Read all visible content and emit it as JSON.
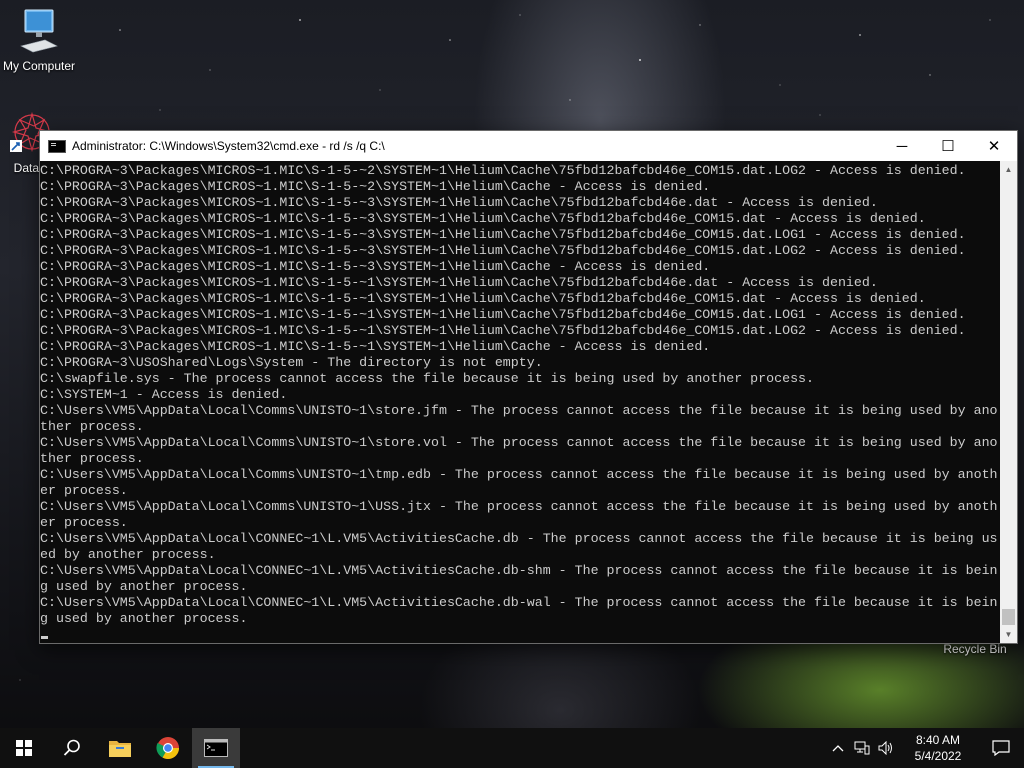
{
  "desktop": {
    "icons": [
      {
        "label": "My Computer"
      },
      {
        "label": "DataW"
      },
      {
        "label": "Recycle Bin"
      }
    ]
  },
  "window": {
    "title": "Administrator: C:\\Windows\\System32\\cmd.exe - rd  /s /q C:\\",
    "controls": {
      "minimize": "─",
      "maximize": "☐",
      "close": "✕"
    }
  },
  "console": {
    "lines": [
      "C:\\PROGRA~3\\Packages\\MICROS~1.MIC\\S-1-5-~2\\SYSTEM~1\\Helium\\Cache\\75fbd12bafcbd46e_COM15.dat.LOG2 - Access is denied.",
      "C:\\PROGRA~3\\Packages\\MICROS~1.MIC\\S-1-5-~2\\SYSTEM~1\\Helium\\Cache - Access is denied.",
      "C:\\PROGRA~3\\Packages\\MICROS~1.MIC\\S-1-5-~3\\SYSTEM~1\\Helium\\Cache\\75fbd12bafcbd46e.dat - Access is denied.",
      "C:\\PROGRA~3\\Packages\\MICROS~1.MIC\\S-1-5-~3\\SYSTEM~1\\Helium\\Cache\\75fbd12bafcbd46e_COM15.dat - Access is denied.",
      "C:\\PROGRA~3\\Packages\\MICROS~1.MIC\\S-1-5-~3\\SYSTEM~1\\Helium\\Cache\\75fbd12bafcbd46e_COM15.dat.LOG1 - Access is denied.",
      "C:\\PROGRA~3\\Packages\\MICROS~1.MIC\\S-1-5-~3\\SYSTEM~1\\Helium\\Cache\\75fbd12bafcbd46e_COM15.dat.LOG2 - Access is denied.",
      "C:\\PROGRA~3\\Packages\\MICROS~1.MIC\\S-1-5-~3\\SYSTEM~1\\Helium\\Cache - Access is denied.",
      "C:\\PROGRA~3\\Packages\\MICROS~1.MIC\\S-1-5-~1\\SYSTEM~1\\Helium\\Cache\\75fbd12bafcbd46e.dat - Access is denied.",
      "C:\\PROGRA~3\\Packages\\MICROS~1.MIC\\S-1-5-~1\\SYSTEM~1\\Helium\\Cache\\75fbd12bafcbd46e_COM15.dat - Access is denied.",
      "C:\\PROGRA~3\\Packages\\MICROS~1.MIC\\S-1-5-~1\\SYSTEM~1\\Helium\\Cache\\75fbd12bafcbd46e_COM15.dat.LOG1 - Access is denied.",
      "C:\\PROGRA~3\\Packages\\MICROS~1.MIC\\S-1-5-~1\\SYSTEM~1\\Helium\\Cache\\75fbd12bafcbd46e_COM15.dat.LOG2 - Access is denied.",
      "C:\\PROGRA~3\\Packages\\MICROS~1.MIC\\S-1-5-~1\\SYSTEM~1\\Helium\\Cache - Access is denied.",
      "C:\\PROGRA~3\\USOShared\\Logs\\System - The directory is not empty.",
      "C:\\swapfile.sys - The process cannot access the file because it is being used by another process.",
      "C:\\SYSTEM~1 - Access is denied.",
      "C:\\Users\\VM5\\AppData\\Local\\Comms\\UNISTO~1\\store.jfm - The process cannot access the file because it is being used by ano",
      "ther process.",
      "C:\\Users\\VM5\\AppData\\Local\\Comms\\UNISTO~1\\store.vol - The process cannot access the file because it is being used by ano",
      "ther process.",
      "C:\\Users\\VM5\\AppData\\Local\\Comms\\UNISTO~1\\tmp.edb - The process cannot access the file because it is being used by anoth",
      "er process.",
      "C:\\Users\\VM5\\AppData\\Local\\Comms\\UNISTO~1\\USS.jtx - The process cannot access the file because it is being used by anoth",
      "er process.",
      "C:\\Users\\VM5\\AppData\\Local\\CONNEC~1\\L.VM5\\ActivitiesCache.db - The process cannot access the file because it is being us",
      "ed by another process.",
      "C:\\Users\\VM5\\AppData\\Local\\CONNEC~1\\L.VM5\\ActivitiesCache.db-shm - The process cannot access the file because it is bein",
      "g used by another process.",
      "C:\\Users\\VM5\\AppData\\Local\\CONNEC~1\\L.VM5\\ActivitiesCache.db-wal - The process cannot access the file because it is bein",
      "g used by another process."
    ]
  },
  "taskbar": {
    "buttons": [
      {
        "icon": "windows-start-icon"
      },
      {
        "icon": "search-icon"
      },
      {
        "icon": "file-explorer-icon"
      },
      {
        "icon": "chrome-icon"
      },
      {
        "icon": "command-prompt-icon",
        "active": true
      }
    ],
    "tray": {
      "icons": [
        "chevron-up-icon",
        "network-icon",
        "volume-icon"
      ],
      "time": "8:40 AM",
      "date": "5/4/2022"
    }
  },
  "colors": {
    "console_bg": "#0c0c0c",
    "console_text": "#cccccc",
    "taskbar_bg": "#101010",
    "active_indicator": "#76b9ed"
  }
}
